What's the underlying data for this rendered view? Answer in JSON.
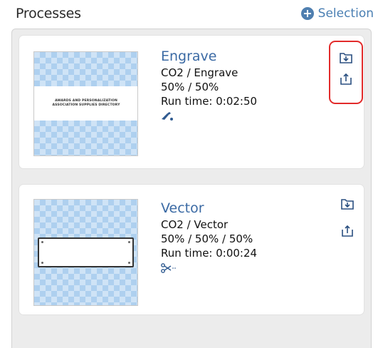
{
  "header": {
    "title": "Processes",
    "selection_label": "Selection"
  },
  "processes": [
    {
      "name": "Engrave",
      "settings": "CO2 / Engrave",
      "values": "50% / 50%",
      "run_time": "Run time: 0:02:50",
      "type_icon": "engrave-brush-icon",
      "thumbnail_text": [
        "AWARDS AND PERSONALIZATION",
        "ASSOCIATION SUPPLIES DIRECTORY"
      ]
    },
    {
      "name": "Vector",
      "settings": "CO2 / Vector",
      "values": "50% / 50% / 50%",
      "run_time": "Run time: 0:00:24",
      "type_icon": "scissors-cut-icon"
    }
  ],
  "colors": {
    "accent": "#3b6aa4",
    "highlight_border": "#e22b2b",
    "panel_bg": "#ececec"
  }
}
